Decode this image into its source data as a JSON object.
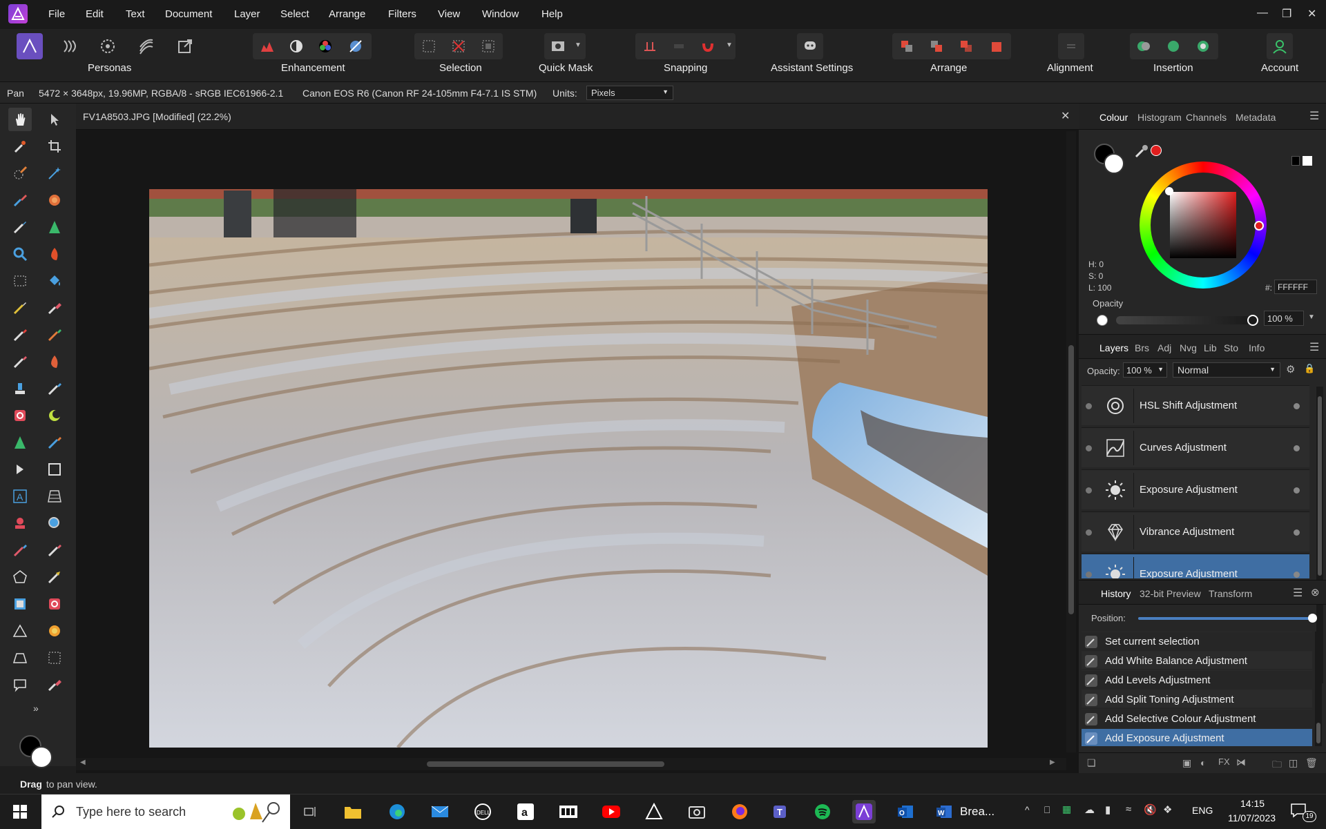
{
  "menu": [
    "File",
    "Edit",
    "Text",
    "Document",
    "Layer",
    "Select",
    "Arrange",
    "Filters",
    "View",
    "Window",
    "Help"
  ],
  "toolbar": {
    "personas": "Personas",
    "enhancement": "Enhancement",
    "selection": "Selection",
    "quick_mask": "Quick Mask",
    "snapping": "Snapping",
    "assistant": "Assistant Settings",
    "arrange": "Arrange",
    "alignment": "Alignment",
    "insertion": "Insertion",
    "account": "Account"
  },
  "context": {
    "tool": "Pan",
    "dimensions": "5472 × 3648px, 19.96MP, RGBA/8 - sRGB IEC61966-2.1",
    "camera": "Canon EOS R6 (Canon RF 24-105mm F4-7.1 IS STM)",
    "units_label": "Units:",
    "units_value": "Pixels"
  },
  "document": {
    "title": "FV1A8503.JPG [Modified] (22.2%)"
  },
  "colour_panel": {
    "tabs": [
      "Colour",
      "Histogram",
      "Channels",
      "Metadata"
    ],
    "h": "H: 0",
    "s": "S: 0",
    "l": "L: 100",
    "hex_label": "#:",
    "hex_value": "FFFFFF",
    "opacity_label": "Opacity",
    "opacity_value": "100 %",
    "accent": "#e01e1e"
  },
  "layers_panel": {
    "tabs": [
      "Layers",
      "Brs",
      "Adj",
      "Nvg",
      "Lib",
      "Sto",
      "Info"
    ],
    "opacity_label": "Opacity:",
    "opacity_value": "100 %",
    "blend_mode": "Normal",
    "layers": [
      {
        "name": "HSL Shift Adjustment",
        "icon": "hsl-icon"
      },
      {
        "name": "Curves Adjustment",
        "icon": "curves-icon"
      },
      {
        "name": "Exposure Adjustment",
        "icon": "exposure-icon"
      },
      {
        "name": "Vibrance Adjustment",
        "icon": "vibrance-icon"
      },
      {
        "name": "Exposure Adjustment",
        "icon": "exposure-icon"
      }
    ]
  },
  "history_panel": {
    "tabs": [
      "History",
      "32-bit Preview",
      "Transform"
    ],
    "position_label": "Position:",
    "items": [
      "Set current selection",
      "Add White Balance Adjustment",
      "Add Levels Adjustment",
      "Add Split Toning Adjustment",
      "Add Selective Colour Adjustment",
      "Add Exposure Adjustment"
    ]
  },
  "status": {
    "bold": "Drag",
    "rest": " to pan view."
  },
  "taskbar": {
    "search_placeholder": "Type here to search",
    "running_app": "Brea...",
    "language": "ENG",
    "time": "14:15",
    "date": "11/07/2023",
    "notifications": "19"
  }
}
